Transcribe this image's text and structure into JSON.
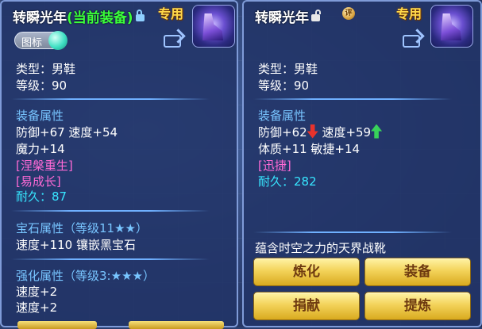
{
  "left_panel": {
    "title": "转瞬光年",
    "equipped_tag": "(当前装备)",
    "special_badge": "专用",
    "toggle_label": "图标",
    "type_line": "类型：男鞋",
    "level_line": "等级：90",
    "equip_attr_header": "装备属性",
    "attr_line1": "防御+67 速度+54",
    "attr_line2": "魔力+14",
    "effect1": "[涅槃重生]",
    "effect2": "[易成长]",
    "durability": "耐久：87",
    "gem_header": "宝石属性（等级11★★）",
    "gem_line": "速度+110 镶嵌黑宝石",
    "enhance_header": "强化属性（等级3:★★★）",
    "enhance_line1": "速度+2",
    "enhance_line2": "速度+2"
  },
  "right_panel": {
    "title": "转瞬光年",
    "special_badge": "专用",
    "medal_text": "评",
    "type_line": "类型：男鞋",
    "level_line": "等级：90",
    "equip_attr_header": "装备属性",
    "attr_def": "防御+62",
    "attr_speed": "速度+59",
    "attr_line2": "体质+11 敏捷+14",
    "effect1": "[迅捷]",
    "durability": "耐久：282",
    "description": "蕴含时空之力的天界战靴",
    "buttons": {
      "refine": "炼化",
      "equip": "装备",
      "donate": "捐献",
      "extract": "提炼"
    }
  },
  "icons": {
    "lock_left": "lock-icon",
    "lock_right": "unlock-icon",
    "share": "share-icon",
    "item": "boots-item-icon"
  },
  "colors": {
    "panel_bg": "#223468",
    "equipped_green": "#3bff3b",
    "special_gold": "#ffd84a",
    "section_blue": "#78c5ff",
    "effect_pink": "#ff6ad6",
    "durability_cyan": "#37e6ff",
    "stat_down": "#e8322c",
    "stat_up": "#38d15a",
    "button_gold": "#f3d35a"
  }
}
